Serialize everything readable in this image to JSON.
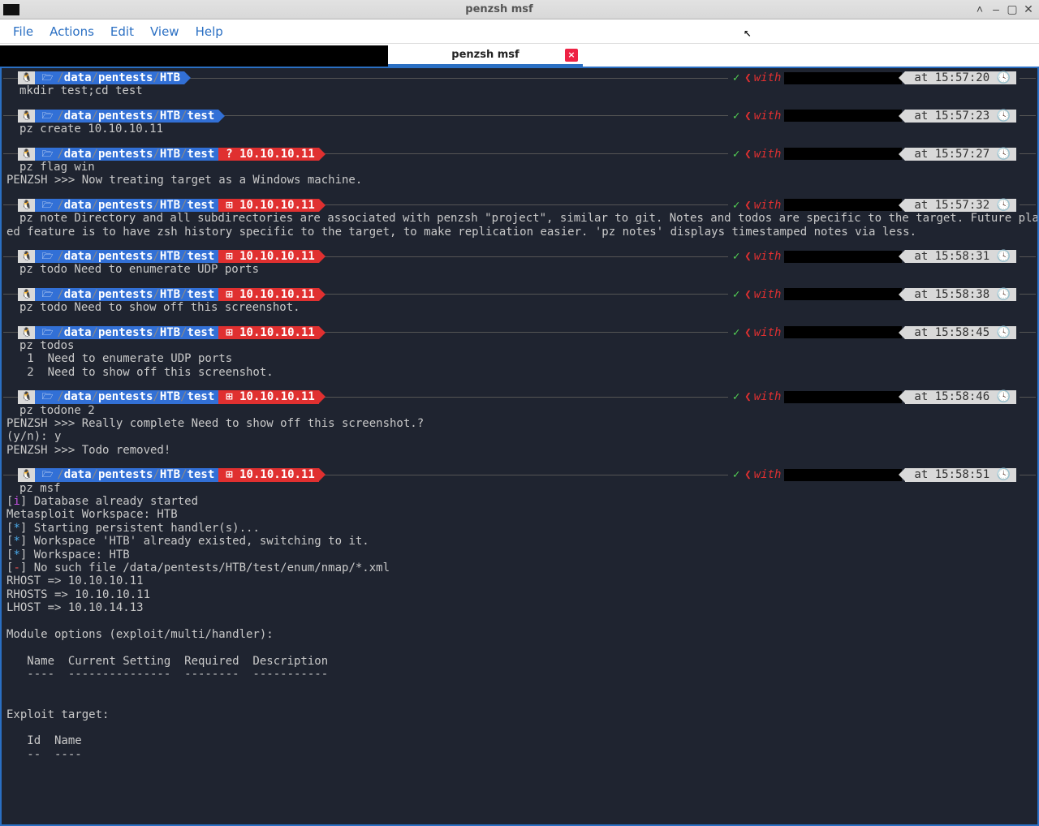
{
  "window": {
    "title": "penzsh msf"
  },
  "menu": [
    "File",
    "Actions",
    "Edit",
    "View",
    "Help"
  ],
  "tabs": {
    "active_label": "penzsh msf"
  },
  "path_full": "/data/pentests/HTB/test",
  "path_base": "/data/pentests/HTB",
  "dir_segments_base": {
    "p0": "/",
    "p1": "data",
    "p2": "/",
    "p3": "pentests",
    "p4": "/",
    "p5": "HTB"
  },
  "dir_segments_test": {
    "p0": "/",
    "p1": "data",
    "p2": "/",
    "p3": "pentests",
    "p4": "/",
    "p5": "HTB",
    "p6": "/",
    "p7": "test"
  },
  "ip": "10.10.10.11",
  "with": "with",
  "prompts": [
    {
      "time": "at 15:57:20 ",
      "cmd": "mkdir test;cd test",
      "path": "base",
      "ip": null,
      "out": []
    },
    {
      "time": "at 15:57:23 ",
      "cmd": "pz create 10.10.10.11",
      "path": "test",
      "ip": null,
      "out": []
    },
    {
      "time": "at 15:57:27 ",
      "cmd": "pz flag win",
      "path": "test",
      "ip": "q",
      "out": [
        "PENZSH >>> Now treating target as a Windows machine."
      ]
    },
    {
      "time": "at 15:57:32 ",
      "cmd": "pz note Directory and all subdirectories are associated with penzsh \"project\", similar to git. Notes and todos are specific to the target. Future plann",
      "path": "test",
      "ip": "win",
      "out": [
        "ed feature is to have zsh history specific to the target, to make replication easier. 'pz notes' displays timestamped notes via less."
      ]
    },
    {
      "time": "at 15:58:31 ",
      "cmd": "pz todo Need to enumerate UDP ports",
      "path": "test",
      "ip": "win",
      "out": []
    },
    {
      "time": "at 15:58:38 ",
      "cmd": "pz todo Need to show off this screenshot.",
      "path": "test",
      "ip": "win",
      "out": []
    },
    {
      "time": "at 15:58:45 ",
      "cmd": "pz todos",
      "path": "test",
      "ip": "win",
      "out": [
        "   1  Need to enumerate UDP ports",
        "   2  Need to show off this screenshot."
      ]
    },
    {
      "time": "at 15:58:46 ",
      "cmd": "pz todone 2",
      "path": "test",
      "ip": "win",
      "out": [
        "PENZSH >>> Really complete Need to show off this screenshot.?",
        "(y/n): y",
        "PENZSH >>> Todo removed!"
      ]
    },
    {
      "time": "at 15:58:51 ",
      "cmd": "pz msf",
      "path": "test",
      "ip": "win",
      "out": []
    }
  ],
  "msf": {
    "l0_pre": "[",
    "l0_i": "i",
    "l0_post": "] Database already started",
    "l1": "Metasploit Workspace: HTB",
    "l2_pre": "[",
    "l2_s": "*",
    "l2_post": "] Starting persistent handler(s)...",
    "l3_pre": "[",
    "l3_s": "*",
    "l3_post": "] Workspace 'HTB' already existed, switching to it.",
    "l4_pre": "[",
    "l4_s": "*",
    "l4_post": "] Workspace: HTB",
    "l5_pre": "[",
    "l5_e": "-",
    "l5_post": "] No such file /data/pentests/HTB/test/enum/nmap/*.xml",
    "l6": "RHOST => 10.10.10.11",
    "l7": "RHOSTS => 10.10.10.11",
    "l8": "LHOST => 10.10.14.13",
    "l9": "",
    "l10": "Module options (exploit/multi/handler):",
    "l11": "",
    "l12": "   Name  Current Setting  Required  Description",
    "l13": "   ----  ---------------  --------  -----------",
    "l14": "",
    "l15": "",
    "l16": "Exploit target:",
    "l17": "",
    "l18": "   Id  Name",
    "l19": "   --  ----"
  },
  "icons": {
    "os": "🐧",
    "folder": "🗁",
    "q": "? ",
    "win": "⊞ ",
    "clock": "🕓"
  }
}
